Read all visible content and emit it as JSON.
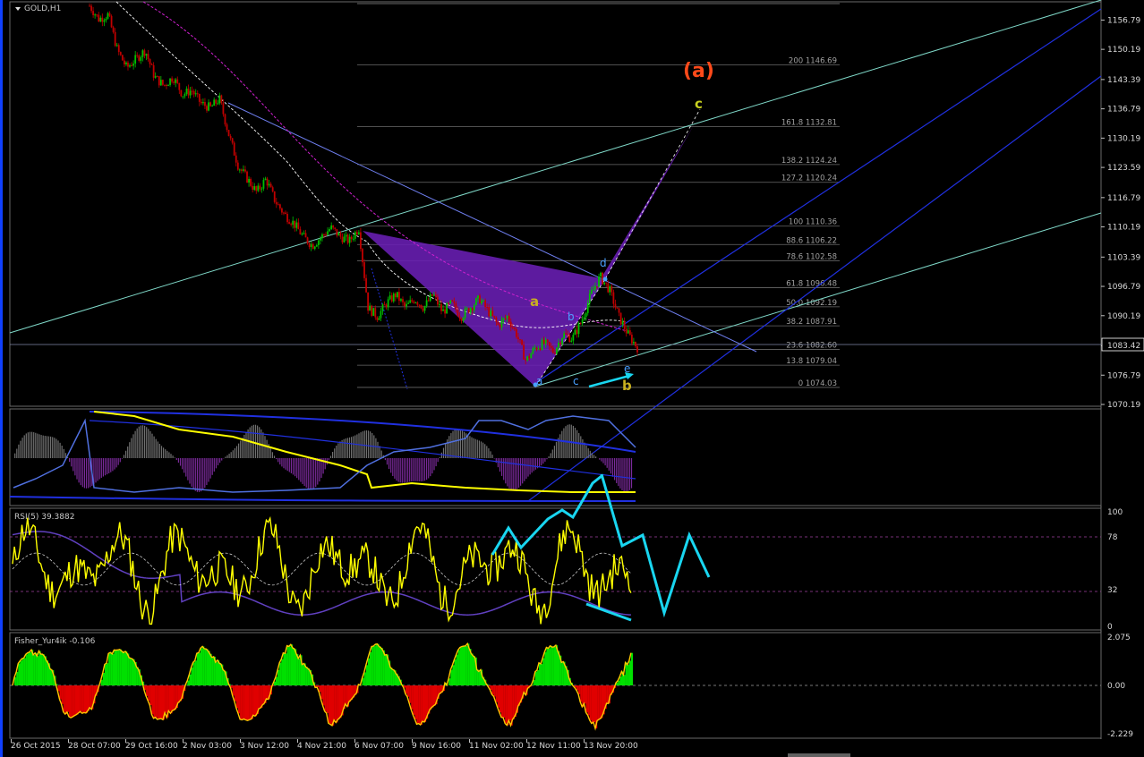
{
  "window": {
    "symbol_label": "GOLD,H1"
  },
  "colors": {
    "background": "#000000",
    "bull": "#00c000",
    "bear": "#c00000",
    "harmonic": "#6a1fb5",
    "channel": "#2030e0",
    "trend": "#7fd8c8",
    "arrows": "#19d6f0",
    "yellow": "#ffff00",
    "orange_label": "#ff4a1a"
  },
  "indicators": {
    "rsi_label": "RSI(5) 39.3882",
    "fisher_label": "Fisher_Yur4ik -0.106"
  },
  "wave_labels": {
    "big": "(a)",
    "c_top": "c",
    "a": "a",
    "b_small": "b",
    "d": "d",
    "a_small": "a",
    "c_small": "c",
    "e": "e",
    "b": "b"
  },
  "chart_data": [
    {
      "type": "candlestick",
      "title": "GOLD,H1",
      "y_ticks": [
        "1156.79",
        "1150.19",
        "1143.39",
        "1136.79",
        "1130.19",
        "1123.59",
        "1116.79",
        "1110.19",
        "1103.39",
        "1096.79",
        "1090.19",
        "1083.42",
        "1076.79",
        "1070.19"
      ],
      "current_price": "1083.42",
      "x_ticks": [
        "26 Oct 2015",
        "28 Oct 07:00",
        "29 Oct 16:00",
        "2 Nov 03:00",
        "3 Nov 12:00",
        "4 Nov 21:00",
        "6 Nov 07:00",
        "9 Nov 16:00",
        "11 Nov 02:00",
        "12 Nov 11:00",
        "13 Nov 20:00"
      ],
      "ylim": [
        1070.19,
        1160.5
      ],
      "close_path": [
        1160,
        1157,
        1158,
        1150,
        1146,
        1148,
        1150,
        1144,
        1142,
        1144,
        1140,
        1141,
        1138,
        1137,
        1139,
        1131,
        1124,
        1121,
        1118,
        1121,
        1116,
        1113,
        1111,
        1108,
        1106,
        1108,
        1110,
        1108,
        1107,
        1110,
        1092,
        1090,
        1093,
        1095,
        1092,
        1094,
        1092,
        1095,
        1091,
        1093,
        1090,
        1092,
        1094,
        1091,
        1088,
        1090,
        1086,
        1080,
        1083,
        1084,
        1082,
        1086,
        1085,
        1089,
        1095,
        1099,
        1096,
        1090,
        1086,
        1083
      ],
      "fibonacci": [
        {
          "label": "200",
          "price": "1146.69"
        },
        {
          "label": "161.8",
          "price": "1132.81"
        },
        {
          "label": "138.2",
          "price": "1124.24"
        },
        {
          "label": "127.2",
          "price": "1120.24"
        },
        {
          "label": "100",
          "price": "1110.36"
        },
        {
          "label": "88.6",
          "price": "1106.22"
        },
        {
          "label": "78.6",
          "price": "1102.58"
        },
        {
          "label": "61.8",
          "price": "1096.48"
        },
        {
          "label": "50.0",
          "price": "1092.19"
        },
        {
          "label": "38.2",
          "price": "1087.91"
        },
        {
          "label": "23.6",
          "price": "1082.60"
        },
        {
          "label": "13.8",
          "price": "1079.04"
        },
        {
          "label": "0",
          "price": "1074.03"
        }
      ]
    },
    {
      "type": "line",
      "title": "RSI(5) 39.3882",
      "y_ticks": [
        "100",
        "78",
        "32",
        "0"
      ],
      "ylim": [
        0,
        100
      ],
      "levels": [
        78,
        32
      ]
    },
    {
      "type": "area",
      "title": "Fisher_Yur4ik -0.106",
      "y_ticks": [
        "2.075",
        "0.00",
        "-2.229"
      ],
      "ylim": [
        -2.229,
        2.075
      ]
    }
  ]
}
